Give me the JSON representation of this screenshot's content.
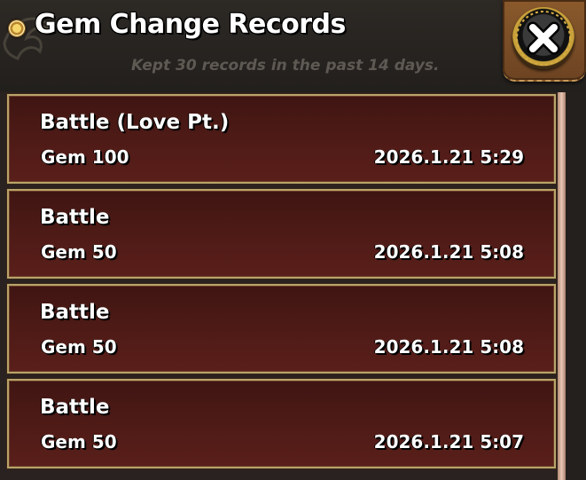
{
  "header": {
    "title": "Gem Change Records",
    "subtitle": "Kept 30 records in the past 14 days."
  },
  "records": [
    {
      "source": "Battle (Love Pt.)",
      "amount": "Gem 100",
      "time": "2026.1.21 5:29"
    },
    {
      "source": "Battle",
      "amount": "Gem 50",
      "time": "2026.1.21 5:08"
    },
    {
      "source": "Battle",
      "amount": "Gem 50",
      "time": "2026.1.21 5:08"
    },
    {
      "source": "Battle",
      "amount": "Gem 50",
      "time": "2026.1.21 5:07"
    }
  ],
  "icons": {
    "title_bullet": "gold-orb-icon",
    "close": "close-x-icon"
  },
  "colors": {
    "record_bg": "#4d1a16",
    "record_border": "#b7a56a",
    "header_bg": "#2a2622",
    "subtitle_text": "#5e5953",
    "scrollbar": "#e9c7b6"
  }
}
